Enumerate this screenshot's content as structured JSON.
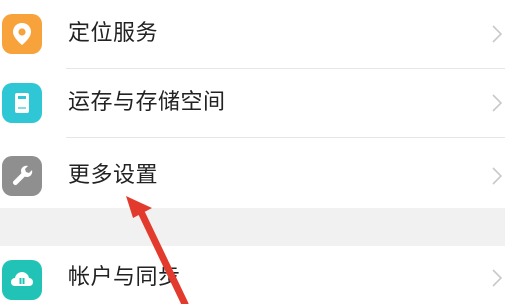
{
  "settings": {
    "items": [
      {
        "label": "定位服务",
        "icon": "location-pin-icon",
        "color": "#f7a23b"
      },
      {
        "label": "运存与存储空间",
        "icon": "storage-icon",
        "color": "#2fc6d6"
      },
      {
        "label": "更多设置",
        "icon": "wrench-icon",
        "color": "#8f8f8f"
      }
    ],
    "account_item": {
      "label": "帐户与同步",
      "icon": "cloud-sync-icon",
      "color": "#21c3b6"
    }
  }
}
